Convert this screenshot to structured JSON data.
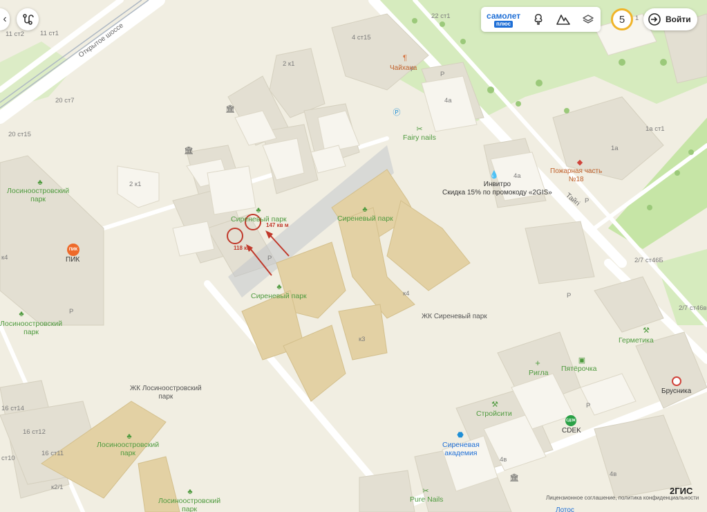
{
  "map": {
    "roads": {
      "open_highway": "Открытое шоссе",
      "taiga": "Тайгі"
    },
    "pois": {
      "chaikhana": "Чайхана",
      "fairy_nails": "Fairy nails",
      "invitro": "Инвитро",
      "invitro_promo": "Скидка 15% по промокоду «2GIS»",
      "fire_station_line1": "Пожарная часть",
      "fire_station_line2": "№18",
      "pik": "ПИК",
      "pik_logo": "ПИК",
      "rigla": "Ригла",
      "pyaterochka": "Пятёрочка",
      "germetika": "Герметика",
      "brusnika": "Брусника",
      "stroysiti": "Стройсити",
      "cdek": "CDEK",
      "cdek_logo": "СДЭК",
      "academy_line1": "Сиреневая",
      "academy_line2": "академия",
      "pure_nails": "Pure Nails",
      "lotos": "Лотос"
    },
    "parks": {
      "los_park_w1": "Лосиноостровский",
      "los_park_w2": "парк",
      "sirenevy_top": "Сиреневый парк",
      "sirenevy_center": "Сиреневый парк",
      "sirenevy_bottom": "Сиреневый парк",
      "los_park_w3": "Лосиноостровский",
      "los_park_w4": "парк",
      "los_park_s1": "Лосиноостровский",
      "los_park_s2": "парк",
      "los_park_b1": "Лосиноостровский",
      "los_park_b2": "парк"
    },
    "districts": {
      "zhk_sirenevy": "ЖК Сиреневый парк",
      "zhk_los_line1": "ЖК Лосиноостровский",
      "zhk_los_line2": "парк"
    },
    "house_numbers": {
      "h11c2": "11 ст2",
      "h11c1": "11 ст1",
      "h20c7": "20 ст7",
      "h20c15": "20 ст15",
      "h4c15": "4 ст15",
      "h2k1a": "2 к1",
      "h2k1b": "2 к1",
      "h22c1": "22 ст1",
      "h4a_a": "4а",
      "h4a_b": "4а",
      "h1a": "1а",
      "h1ac1": "1а ст1",
      "hk4left": "к4",
      "hk4": "к4",
      "hk3": "к3",
      "h27c46b": "2/7 ст46Б",
      "h27c46v": "2/7 ст46в",
      "h16c14": "16 ст14",
      "h16c12": "16 ст12",
      "h16c11": "16 ст11",
      "hc10": "ст10",
      "hk21": "к2/1",
      "h4v_a": "4в",
      "h4v_b": "4в",
      "h1": "1",
      "p_markers": [
        "P",
        "P",
        "P",
        "P",
        "P",
        "P",
        "P"
      ]
    },
    "annotations": {
      "a147": "147 кв м",
      "a118": "118 кв"
    }
  },
  "controls": {
    "samolet_line1": "самолет",
    "samolet_line2": "плюс",
    "zoom_level": "5",
    "login_label": "Войти",
    "left_edge_glyph": "‹"
  },
  "footer": {
    "brand": "2ГИС",
    "links": "Лицензионное соглашение, политика конфиденциальности"
  },
  "colors": {
    "background": "#f1eee2",
    "building": "#e4dfcf",
    "building_tan": "#e3d1a4",
    "park": "#cfe8b0",
    "road": "#ffffff",
    "annotation": "#c0392b",
    "accent_blue": "#1f6fd6",
    "counter_ring": "#f0b429"
  }
}
